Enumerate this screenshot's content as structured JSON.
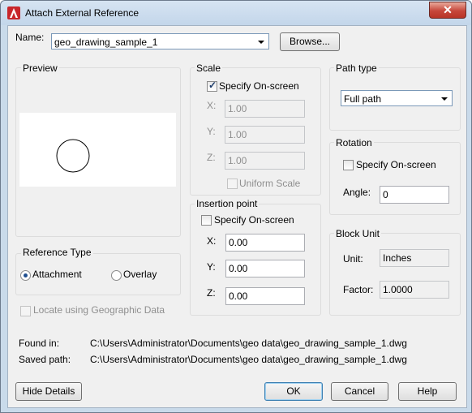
{
  "window": {
    "title": "Attach External Reference",
    "close_glyph": "✕"
  },
  "name": {
    "label": "Name:",
    "value": "geo_drawing_sample_1",
    "browse_label": "Browse..."
  },
  "preview": {
    "title": "Preview"
  },
  "scale": {
    "title": "Scale",
    "specify_label": "Specify On-screen",
    "specify_checked": true,
    "x_label": "X:",
    "x_value": "1.00",
    "y_label": "Y:",
    "y_value": "1.00",
    "z_label": "Z:",
    "z_value": "1.00",
    "uniform_label": "Uniform Scale"
  },
  "path_type": {
    "title": "Path type",
    "value": "Full path"
  },
  "rotation": {
    "title": "Rotation",
    "specify_label": "Specify On-screen",
    "angle_label": "Angle:",
    "angle_value": "0"
  },
  "insertion": {
    "title": "Insertion point",
    "specify_label": "Specify On-screen",
    "x_label": "X:",
    "x_value": "0.00",
    "y_label": "Y:",
    "y_value": "0.00",
    "z_label": "Z:",
    "z_value": "0.00"
  },
  "block_unit": {
    "title": "Block Unit",
    "unit_label": "Unit:",
    "unit_value": "Inches",
    "factor_label": "Factor:",
    "factor_value": "1.0000"
  },
  "reference_type": {
    "title": "Reference Type",
    "attachment_label": "Attachment",
    "overlay_label": "Overlay",
    "selected": "Attachment"
  },
  "geo": {
    "label": "Locate using Geographic Data"
  },
  "paths": {
    "found_label": "Found in:",
    "found_value": "C:\\Users\\Administrator\\Documents\\geo data\\geo_drawing_sample_1.dwg",
    "saved_label": "Saved path:",
    "saved_value": "C:\\Users\\Administrator\\Documents\\geo data\\geo_drawing_sample_1.dwg"
  },
  "buttons": {
    "hide_details": "Hide Details",
    "ok": "OK",
    "cancel": "Cancel",
    "help": "Help"
  },
  "colors": {
    "accent": "#3c7fb1",
    "app_icon": "#c8262b"
  }
}
